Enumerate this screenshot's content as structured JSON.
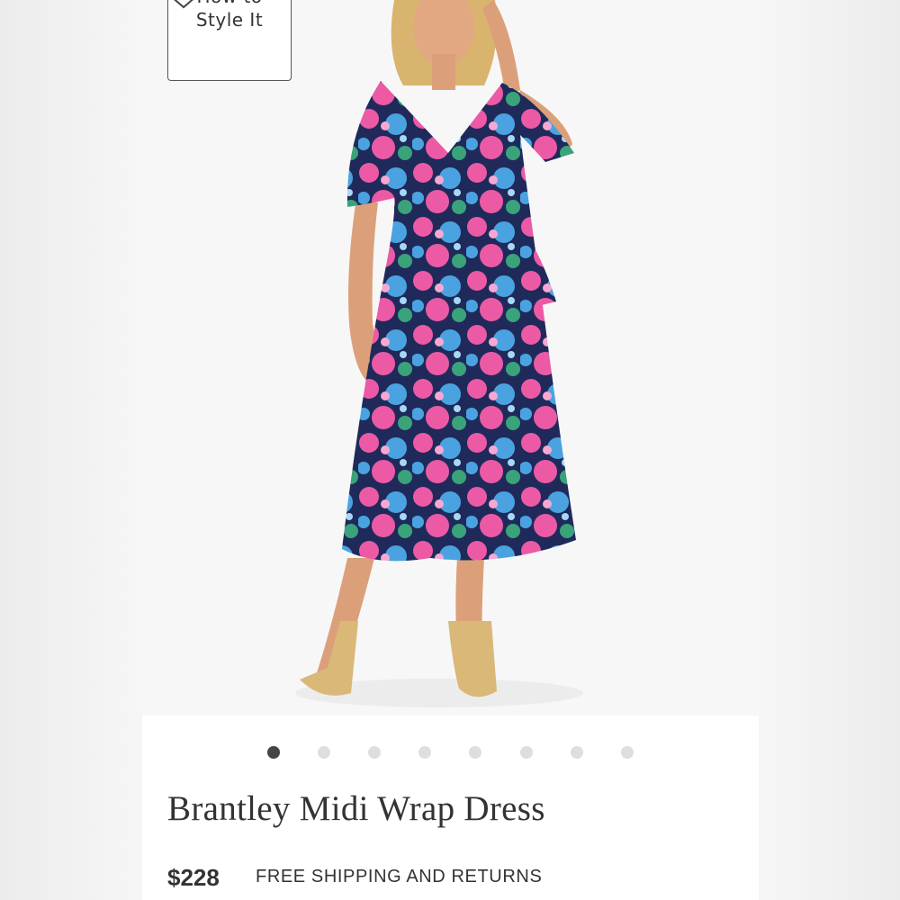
{
  "product": {
    "how_to_style_line1": "How to",
    "how_to_style_line2": "Style It",
    "title": "Brantley Midi Wrap Dress",
    "price": "$228",
    "shipping_note": "FREE SHIPPING AND RETURNS"
  },
  "carousel": {
    "total_slides": 8,
    "active_index": 0
  },
  "icons": {
    "style_toggle": "chevron-down-icon"
  },
  "colors": {
    "text": "#333333",
    "dot_active": "#444444",
    "dot_inactive": "#dedede",
    "print_pink": "#ec5aa6",
    "print_blue": "#4aa3e0",
    "print_navy": "#1f2a5a",
    "print_green": "#3aa37a"
  }
}
